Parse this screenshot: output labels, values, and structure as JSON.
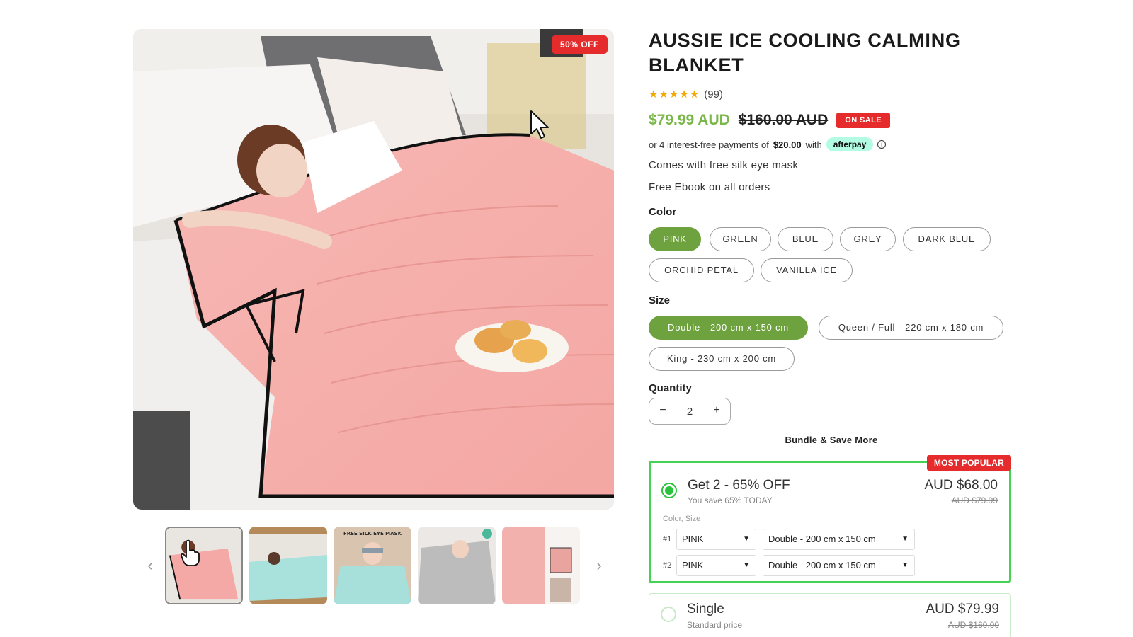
{
  "gallery": {
    "discount_badge": "50% OFF",
    "thumbnails": [
      {
        "icon": "thumb-pink-blanket"
      },
      {
        "icon": "thumb-teal-blanket-bed"
      },
      {
        "icon": "thumb-free-silk-eye-mask",
        "caption": "FREE SILK EYE MASK"
      },
      {
        "icon": "thumb-grey-blanket"
      },
      {
        "icon": "thumb-pink-blanket-collage"
      }
    ],
    "prev_icon": "‹",
    "next_icon": "›"
  },
  "product": {
    "title": "AUSSIE ICE COOLING CALMING BLANKET",
    "stars": "★★★★★",
    "review_count": "(99)",
    "price_now": "$79.99 AUD",
    "price_was": "$160.00 AUD",
    "sale_badge": "ON SALE",
    "afterpay": {
      "prefix": "or 4 interest-free payments of",
      "amount": "$20.00",
      "with": "with",
      "brand": "afterpay",
      "info": "i"
    },
    "perks": [
      "Comes with free silk eye mask",
      "Free Ebook on all orders"
    ]
  },
  "color": {
    "label": "Color",
    "options": [
      "PINK",
      "GREEN",
      "BLUE",
      "GREY",
      "DARK BLUE",
      "ORCHID PETAL",
      "VANILLA ICE"
    ],
    "selected": "PINK"
  },
  "size": {
    "label": "Size",
    "options": [
      "Double - 200 cm x 150 cm",
      "Queen / Full - 220 cm x 180 cm",
      "King - 230 cm x 200 cm"
    ],
    "selected": "Double - 200 cm x 150 cm"
  },
  "quantity": {
    "label": "Quantity",
    "minus": "−",
    "value": "2",
    "plus": "+"
  },
  "bundle": {
    "heading": "Bundle & Save More",
    "offers": [
      {
        "title": "Get 2 - 65% OFF",
        "subtitle": "You save 65% TODAY",
        "price": "AUD $68.00",
        "was": "AUD $79.99",
        "badge": "MOST POPULAR",
        "variant_label": "Color, Size",
        "rows": [
          {
            "num": "#1",
            "color": "PINK",
            "size": "Double - 200 cm x 150 cm"
          },
          {
            "num": "#2",
            "color": "PINK",
            "size": "Double - 200 cm x 150 cm"
          }
        ],
        "selected": true
      },
      {
        "title": "Single",
        "subtitle": "Standard price",
        "price": "AUD $79.99",
        "was": "AUD $160.00",
        "selected": false
      }
    ]
  },
  "colors": {
    "accent_green": "#6ea23e",
    "price_green": "#7ab648",
    "sale_red": "#e52b2b",
    "bundle_border": "#45d255",
    "afterpay_mint": "#b2fce4"
  }
}
